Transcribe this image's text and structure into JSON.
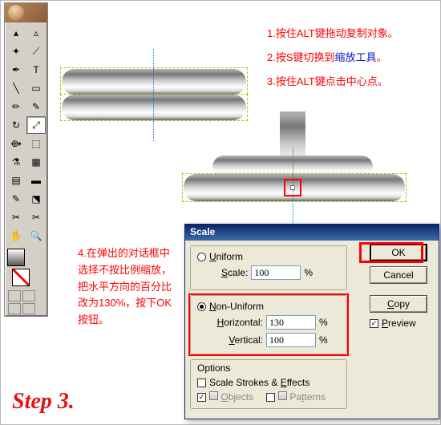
{
  "toolbox": {
    "tools": [
      "↖",
      "⬚",
      "✦",
      "⤢",
      "✎",
      "T",
      "▭",
      "◯",
      "✏",
      "〰",
      "↻",
      "⟴",
      "✂",
      "⚗",
      "▦",
      "▤",
      "⬚",
      "⬔",
      "◧",
      "⬓",
      "✂",
      "✂",
      "✋",
      "⤢",
      "⬚",
      "🔍"
    ]
  },
  "instructions": {
    "line1_a": "1.按住ALT键拖动复制对象。",
    "line2_a": "2.按S键切换到",
    "line2_b": "缩放工具",
    "line2_c": "。",
    "line3_a": "3.按住ALT键点击中心点。",
    "note4_a": "4.在弹出的对话框中选择",
    "note4_b": "不按比例缩放",
    "note4_c": "，把水平方向的百分比改为130%，按下OK按钮。"
  },
  "step_label": "Step 3.",
  "dialog": {
    "title": "Scale",
    "uniform_label": "Uniform",
    "scale_label": "Scale:",
    "scale_value": "100",
    "percent": "%",
    "nonuniform_label": "Non-Uniform",
    "horizontal_label": "Horizontal:",
    "horizontal_value": "130",
    "vertical_label": "Vertical:",
    "vertical_value": "100",
    "options_label": "Options",
    "scale_strokes_label": "Scale Strokes & Effects",
    "objects_label": "Objects",
    "patterns_label": "Patterns",
    "ok": "OK",
    "cancel": "Cancel",
    "copy": "Copy",
    "preview": "Preview"
  }
}
